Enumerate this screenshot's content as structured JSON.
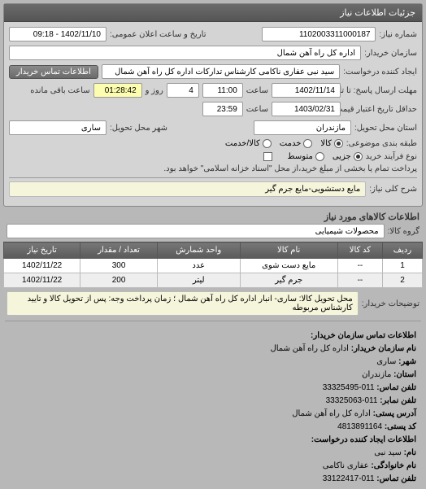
{
  "panel_title": "جزئیات اطلاعات نیاز",
  "fields": {
    "number_label": "شماره نیاز:",
    "number_value": "1102003311000187",
    "announce_label": "تاریخ و ساعت اعلان عمومی:",
    "announce_value": "1402/11/10 - 09:18",
    "buyer_label": "سازمان خریدار:",
    "buyer_value": "اداره کل راه آهن شمال",
    "requester_label": "ایجاد کننده درخواست:",
    "requester_value": "سید نبی عفاری ناکامی کارشناس تدارکات اداره کل راه آهن شمال",
    "contact_btn": "اطلاعات تماس خریدار",
    "deadline_label": "مهلت ارسال پاسخ: تا تاریخ:",
    "deadline_date": "1402/11/14",
    "time_label": "ساعت",
    "deadline_time": "11:00",
    "days_label": "روز و",
    "days_value": "4",
    "remain_label": "ساعت باقی مانده",
    "remain_value": "01:28:42",
    "valid_label": "حداقل تاریخ اعتبار قیمت: تا تاریخ:",
    "valid_date": "1403/02/31",
    "valid_time": "23:59",
    "province_label": "استان محل تحویل:",
    "province_value": "مازندران",
    "city_label": "شهر محل تحویل:",
    "city_value": "ساری",
    "category_label": "طبقه بندی موضوعی:",
    "process_label": "نوع فرآیند خرید",
    "payment_note": "پرداخت تمام یا بخشی از مبلغ خرید،از محل \"اسناد خزانه اسلامی\" خواهد بود.",
    "desc_label": "شرح کلی نیاز:",
    "desc_value": "مایع دستشویی-مایع جرم گیر",
    "group_label": "گروه کالا:",
    "group_value": "محصولات شیمیایی",
    "notes_label": "توضیحات خریدار:",
    "notes_value": "محل تحویل کالا: ساری- انبار اداره کل راه آهن شمال ؛ زمان پرداخت وجه: پس از تحویل کالا و تایید کارشناس مربوطه"
  },
  "radios": {
    "cat_goods": "کالا",
    "cat_service": "خدمت",
    "cat_both": "کالا/خدمت",
    "proc_small": "جزیی",
    "proc_medium": "متوسط"
  },
  "items_title": "اطلاعات کالاهای مورد نیاز",
  "table": {
    "headers": [
      "ردیف",
      "کد کالا",
      "نام کالا",
      "واحد شمارش",
      "تعداد / مقدار",
      "تاریخ نیاز"
    ],
    "rows": [
      [
        "1",
        "--",
        "مایع دست شوی",
        "عدد",
        "300",
        "1402/11/22"
      ],
      [
        "2",
        "--",
        "جرم گیر",
        "لیتر",
        "200",
        "1402/11/22"
      ]
    ]
  },
  "contact": {
    "buyer_org_title": "اطلاعات تماس سازمان خریدار:",
    "org_name_label": "نام سازمان خریدار:",
    "org_name": "اداره کل راه آهن شمال",
    "city_label": "شهر:",
    "city": "ساری",
    "province_label": "استان:",
    "province": "مازندران",
    "phone_label": "تلفن تماس:",
    "phone": "011-33325495",
    "fax_label": "تلفن نمابر:",
    "fax": "011-33325063",
    "addr_label": "آدرس پستی:",
    "addr": "اداره کل راه آهن شمال",
    "postal_label": "کد پستی:",
    "postal": "4813891164",
    "requester_title": "اطلاعات ایجاد کننده درخواست:",
    "fname_label": "نام:",
    "fname": "سید نبی",
    "lname_label": "نام خانوادگی:",
    "lname": "عفاری ناکامی",
    "rphone_label": "تلفن تماس:",
    "rphone": "011-33122417"
  }
}
